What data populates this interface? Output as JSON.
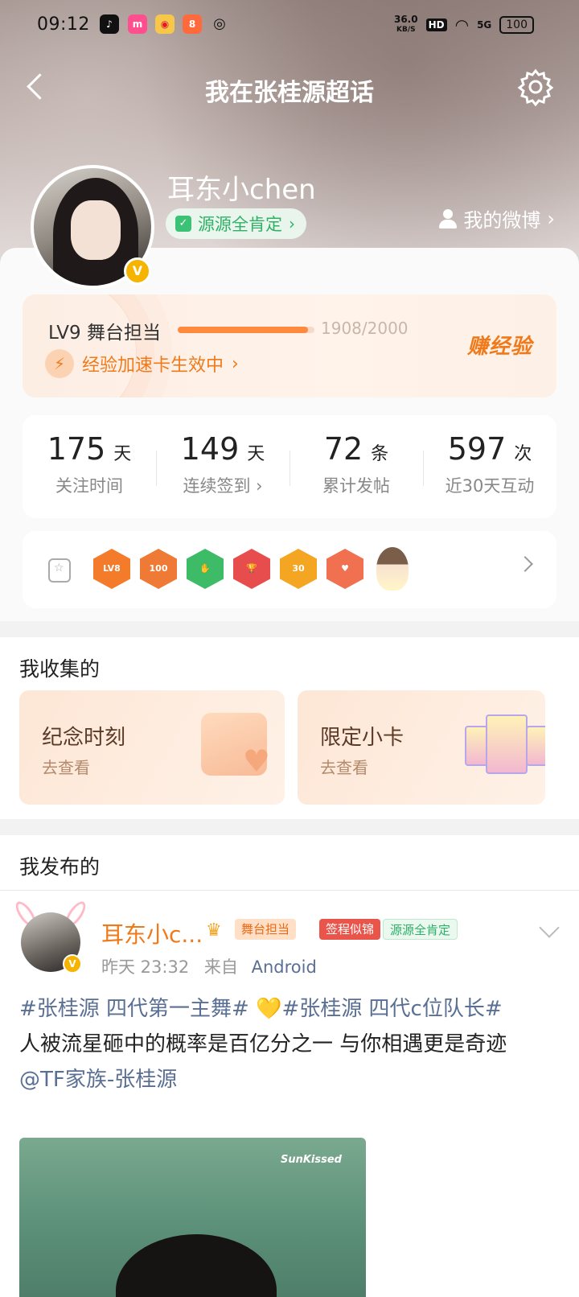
{
  "status": {
    "time": "09:12",
    "net_speed": "36.0",
    "net_unit": "KB/S",
    "hd": "HD",
    "signal": "5G",
    "battery": "100"
  },
  "nav": {
    "title": "我在张桂源超话"
  },
  "profile": {
    "username": "耳东小chen",
    "tag": "源源全肯定",
    "my_weibo": "我的微博"
  },
  "level": {
    "label": "LV9 舞台担当",
    "progress_text": "1908/2000",
    "progress_fraction": 0.954,
    "boost": "经验加速卡生效中",
    "earn": "赚经验"
  },
  "stats": [
    {
      "num": "175",
      "unit": "天",
      "label": "关注时间"
    },
    {
      "num": "149",
      "unit": "天",
      "label": "连续签到 ›"
    },
    {
      "num": "72",
      "unit": "条",
      "label": "累计发帖"
    },
    {
      "num": "597",
      "unit": "次",
      "label": "近30天互动"
    }
  ],
  "badges": [
    {
      "text": "LV8",
      "color": "#f47b2a"
    },
    {
      "text": "100",
      "color": "#ee7a35"
    },
    {
      "text": "✋",
      "color": "#3dbb67"
    },
    {
      "text": "🏆",
      "color": "#e84d4d"
    },
    {
      "text": "30",
      "color": "#f4a623"
    },
    {
      "text": "♥",
      "color": "#f07050"
    }
  ],
  "collect": {
    "title": "我收集的",
    "moments": {
      "title": "纪念时刻",
      "sub": "去查看"
    },
    "cards": {
      "title": "限定小卡",
      "sub": "去查看"
    }
  },
  "posts": {
    "title": "我发布的",
    "author": "耳东小c...",
    "chip_level": "舞台担当",
    "chip_red": "签程似锦",
    "chip_green": "源源全肯定",
    "time": "昨天 23:32",
    "source_prefix": "来自",
    "source": "Android",
    "topic1": "#张桂源 四代第一主舞#",
    "heart": "💛",
    "topic2": "#张桂源 四代c位队长#",
    "text": "人被流星砸中的概率是百亿分之一 与你相遇更是奇迹",
    "mention": "@TF家族-张桂源",
    "image_brand": "SunKissed"
  }
}
